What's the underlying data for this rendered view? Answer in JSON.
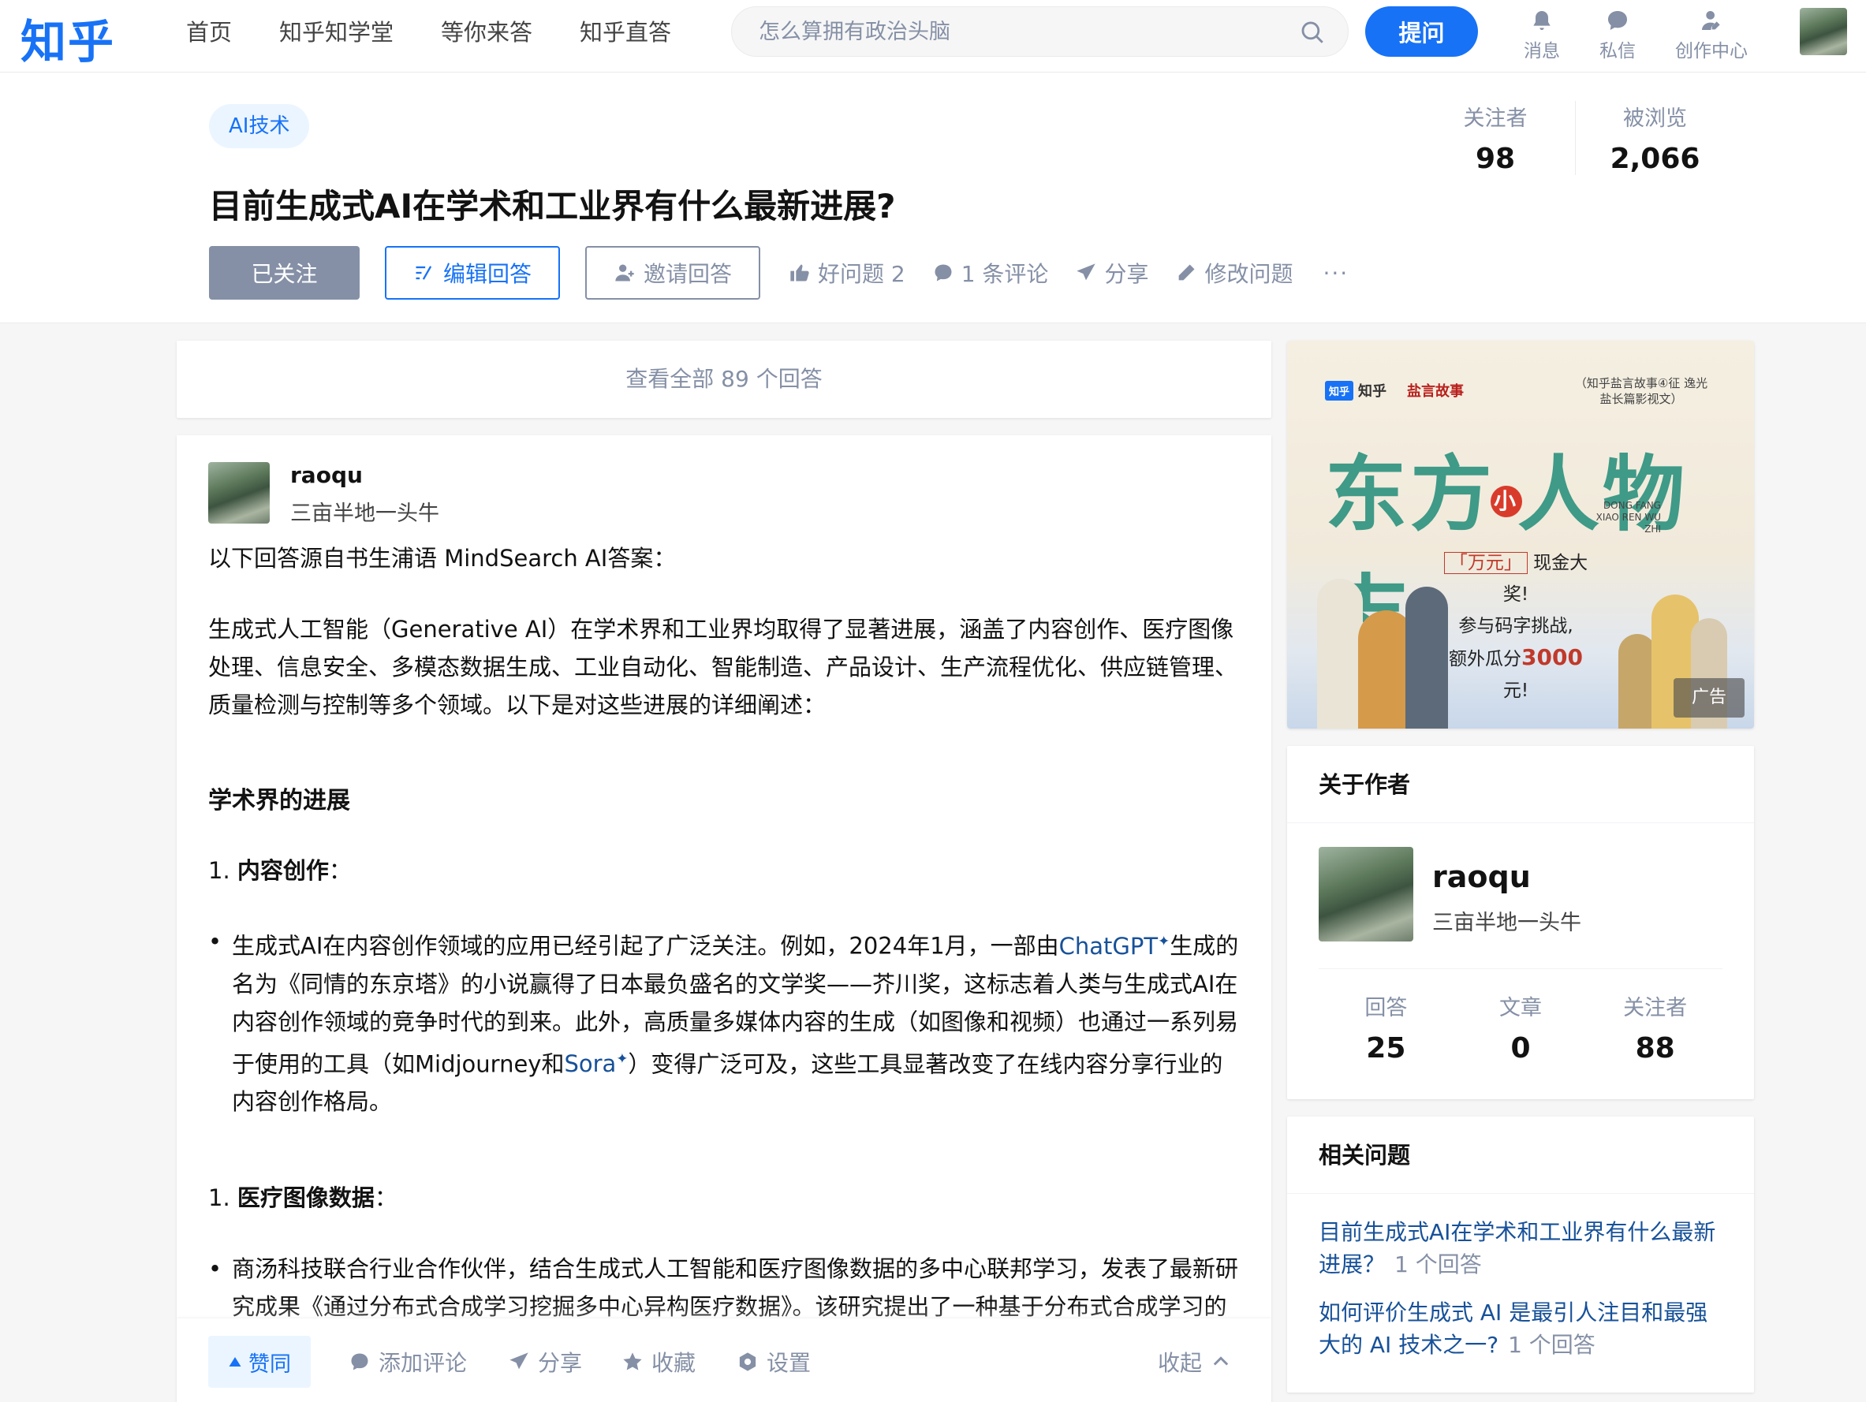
{
  "header": {
    "logo": "知乎",
    "nav": [
      "首页",
      "知乎知学堂",
      "等你来答",
      "知乎直答"
    ],
    "search_placeholder": "怎么算拥有政治头脑",
    "ask_label": "提问",
    "icons": {
      "messages_label": "消息",
      "dm_label": "私信",
      "creator_label": "创作中心"
    }
  },
  "question": {
    "topic": "AI技术",
    "title": "目前生成式AI在学术和工业界有什么最新进展?",
    "followers_label": "关注者",
    "followers": "98",
    "views_label": "被浏览",
    "views": "2,066",
    "actions": {
      "followed": "已关注",
      "edit_answer": "编辑回答",
      "invite": "邀请回答",
      "good_question": "好问题 2",
      "comments": "1 条评论",
      "share": "分享",
      "edit_question": "修改问题",
      "more": "···"
    }
  },
  "view_all": "查看全部 89 个回答",
  "answer": {
    "author_name": "raoqu",
    "author_bio": "三亩半地一头牛",
    "intro": "以下回答源自书生浦语 MindSearch AI答案：",
    "summary": "生成式人工智能（Generative AI）在学术界和工业界均取得了显著进展，涵盖了内容创作、医疗图像处理、信息安全、多模态数据生成、工业自动化、智能制造、产品设计、生产流程优化、供应链管理、质量检测与控制等多个领域。以下是对这些进展的详细阐述：",
    "section_title": "学术界的进展",
    "sub1_num": "1. ",
    "sub1_title": "内容创作",
    "sub1_colon": "：",
    "bullet1_a": "生成式AI在内容创作领域的应用已经引起了广泛关注。例如，2024年1月，一部由",
    "bullet1_link1": "ChatGPT",
    "bullet1_b": "生成的名为《同情的东京塔》的小说赢得了日本最负盛名的文学奖——芥川奖，这标志着人类与生成式AI在内容创作领域的竞争时代的到来。此外，高质量多媒体内容的生成（如图像和视频）也通过一系列易于使用的工具（如Midjourney和",
    "bullet1_link2": "Sora",
    "bullet1_c": "）变得广泛可及，这些工具显著改变了在线内容分享行业的内容创作格局。",
    "sub2_num": "1. ",
    "sub2_title": "医疗图像数据",
    "sub2_colon": "：",
    "bullet2": "商汤科技联合行业合作伙伴，结合生成式人工智能和医疗图像数据的多中心联邦学习，发表了最新研究成果《通过分布式合成学习挖掘多中心异构医疗数据》。该研究提出了一种基于分布式合成学习的方法，能够在保护数据隐私的前提下实现多中心医疗数据的协同利用。",
    "link_mark": "✦",
    "actions": {
      "agree": "赞同",
      "comment": "添加评论",
      "share": "分享",
      "collect": "收藏",
      "settings": "设置",
      "collapse": "收起"
    }
  },
  "ad": {
    "logo_zhihu": "知乎",
    "logo_zhihu_small": "知乎",
    "logo_yanyan": "盐言故事",
    "corner_text": "（知乎盐言故事④征 逸光盐长篇影视文）",
    "title_a": "东方",
    "title_small": "小",
    "title_b": "人物志",
    "pinyin": "DONG FANG XIAO REN WU ZHI",
    "prize_hl": "「万元」",
    "prize_a": "现金大奖!",
    "prize_b": "参与码字挑战,",
    "prize_c_pre": "额外瓜分",
    "prize_num": "3000",
    "prize_c_post": "元!",
    "badge": "广告"
  },
  "about_author": {
    "header": "关于作者",
    "name": "raoqu",
    "bio": "三亩半地一头牛",
    "stats": [
      {
        "label": "回答",
        "value": "25"
      },
      {
        "label": "文章",
        "value": "0"
      },
      {
        "label": "关注者",
        "value": "88"
      }
    ]
  },
  "related": {
    "header": "相关问题",
    "items": [
      {
        "title": "目前生成式AI在学术和工业界有什么最新进展？",
        "count": "1 个回答"
      },
      {
        "title": "如何评价生成式 AI 是最引人注目和最强大的 AI 技术之一?",
        "count": "1 个回答"
      }
    ]
  },
  "colors": {
    "brand_blue": "#1772f6",
    "link_blue": "#175199",
    "muted_gray": "#8590a6",
    "ad_title_teal": "#3f9a87",
    "ad_red": "#c0392b"
  }
}
